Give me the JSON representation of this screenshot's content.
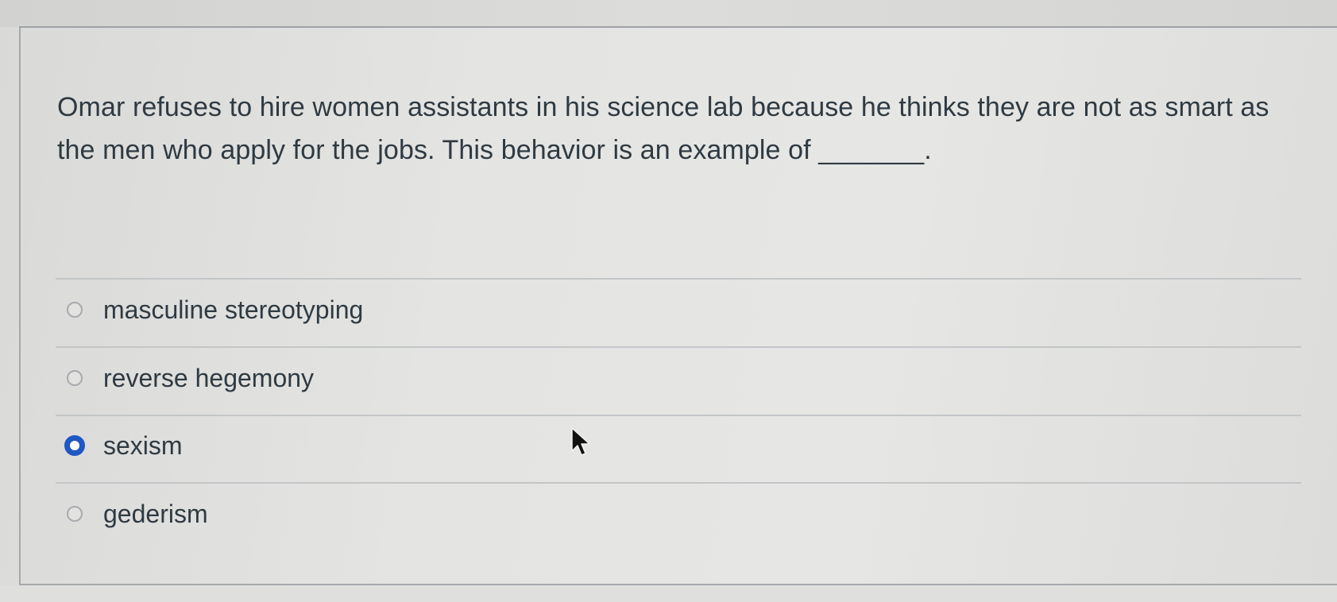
{
  "question": {
    "text": "Omar refuses to hire women assistants in his science lab because he thinks they are not as smart as the men who apply for the jobs. This behavior is an example of _______."
  },
  "answers": [
    {
      "label": "masculine stereotyping",
      "selected": false
    },
    {
      "label": "reverse hegemony",
      "selected": false
    },
    {
      "label": "sexism",
      "selected": true
    },
    {
      "label": "gederism",
      "selected": false
    }
  ],
  "colors": {
    "selected_radio": "#1f57c3",
    "text": "#2f3a42",
    "divider": "#c3c6c8"
  },
  "icons": {
    "cursor": "mouse-pointer-icon",
    "radio_selected": "radio-checked-icon",
    "radio_unselected": "radio-unchecked-icon"
  }
}
